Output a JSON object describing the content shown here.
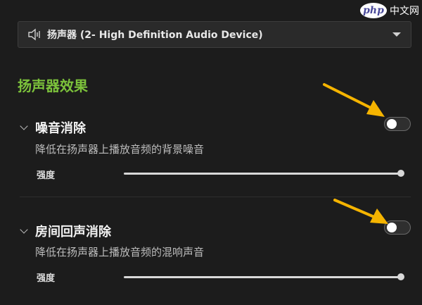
{
  "watermark": {
    "logo": "php",
    "text": "中文网"
  },
  "device": {
    "label": "扬声器 (2- High Definition Audio Device)"
  },
  "section_title": "扬声器效果",
  "features": [
    {
      "title": "噪音消除",
      "description": "降低在扬声器上播放音频的背景噪音",
      "strength_label": "强度",
      "strength": 1.0,
      "enabled": false
    },
    {
      "title": "房间回声消除",
      "description": "降低在扬声器上播放音频的混响声音",
      "strength_label": "强度",
      "strength": 1.0,
      "enabled": false
    }
  ],
  "colors": {
    "accent": "#7cc23b",
    "annotation_arrow": "#f5b400"
  },
  "icons": [
    "speaker-icon",
    "chevron-down-icon",
    "expand-chevron-icon"
  ]
}
